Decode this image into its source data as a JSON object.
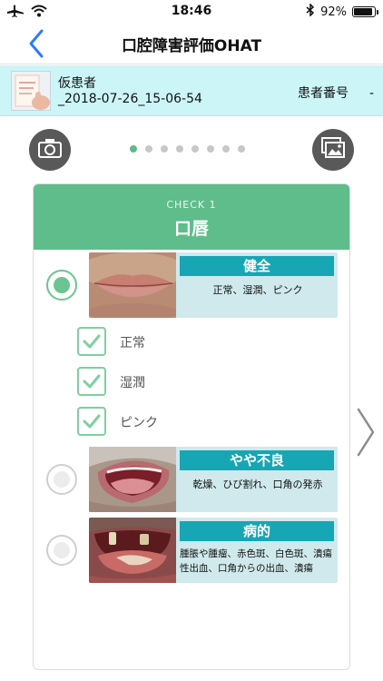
{
  "status_bar": {
    "time": "18:46",
    "battery_text": "92%",
    "battery_level": 0.92,
    "icons": [
      "airplane-icon",
      "wifi-icon",
      "bluetooth-icon",
      "battery-icon"
    ]
  },
  "nav": {
    "title": "口腔障害評価OHAT",
    "back_icon": "chevron-left-icon"
  },
  "patient": {
    "name": "仮患者",
    "record": "_2018-07-26_15-06-54",
    "id_label": "患者番号",
    "id_value": "-"
  },
  "pager": {
    "total": 8,
    "current": 1,
    "camera_icon": "camera-icon",
    "gallery_icon": "photo-gallery-icon"
  },
  "card": {
    "check_label": "CHECK 1",
    "title": "口唇",
    "options": [
      {
        "label": "健全",
        "description": "正常、湿潤、ピンク",
        "selected": true
      },
      {
        "label": "やや不良",
        "description": "乾燥、ひび割れ、口角の発赤",
        "selected": false
      },
      {
        "label": "病的",
        "description": "腫脹や腫瘤、赤色斑、白色斑、潰瘍性出血、口角からの出血、潰瘍",
        "selected": false
      }
    ],
    "checks": [
      {
        "label": "正常",
        "checked": true
      },
      {
        "label": "湿潤",
        "checked": true
      },
      {
        "label": "ピンク",
        "checked": true
      }
    ]
  },
  "colors": {
    "accent_green": "#5fbd8b",
    "label_teal": "#17a6b4",
    "patient_bar": "#ccf5f7",
    "ios_blue": "#2f7bf5"
  }
}
